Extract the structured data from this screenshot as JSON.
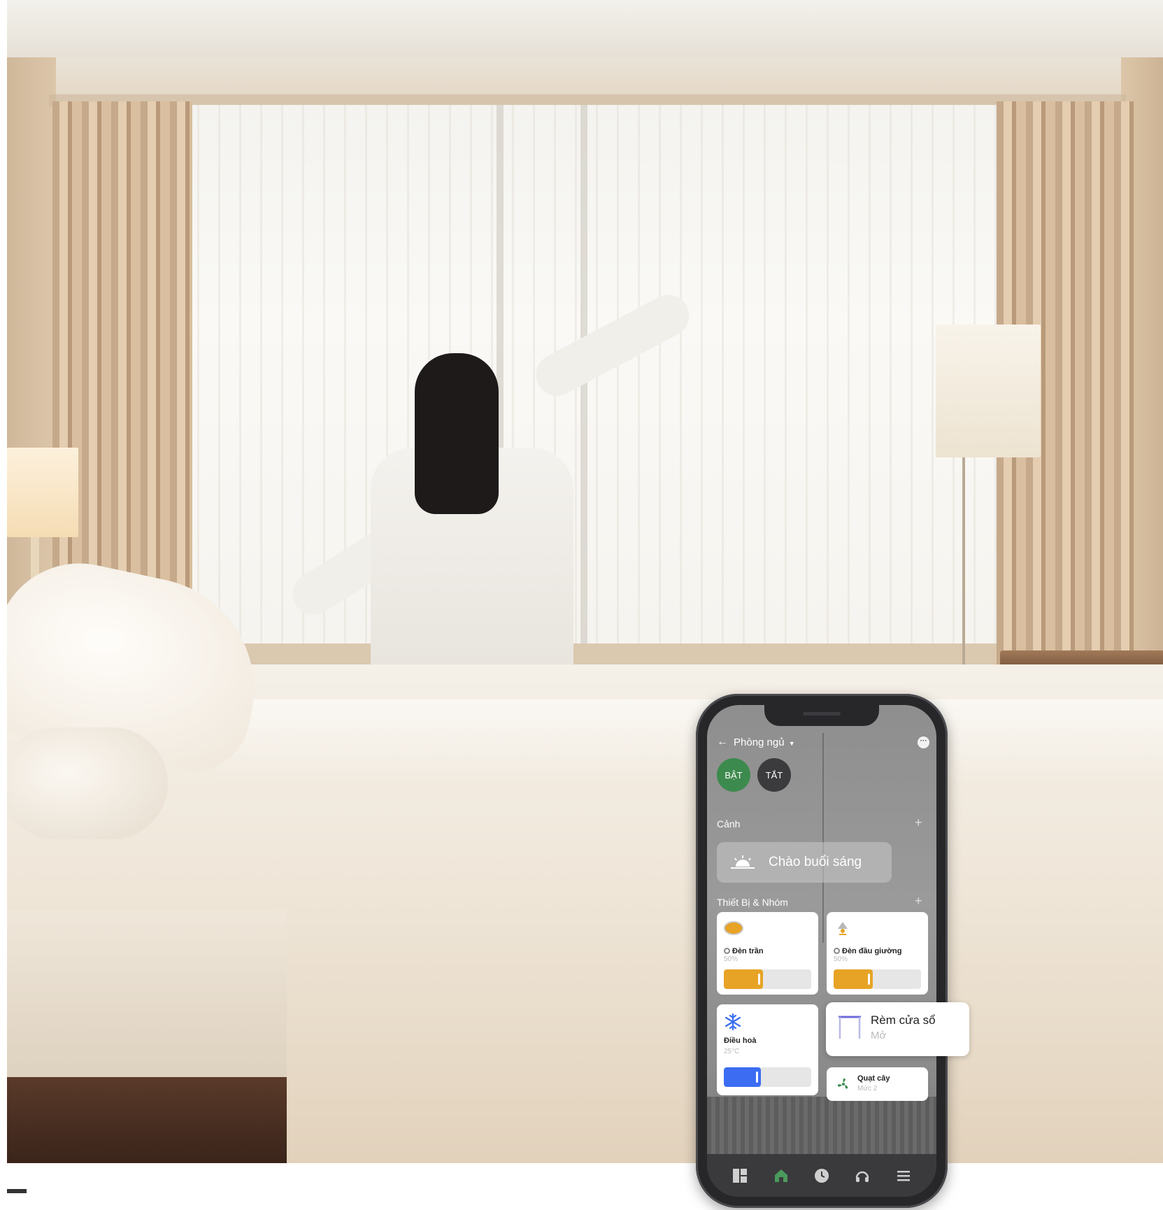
{
  "app": {
    "header": {
      "back_icon": "arrow-left-icon",
      "room_title": "Phòng ngủ",
      "dropdown_icon": "caret-down-icon",
      "more_icon": "more-horizontal-icon"
    },
    "power": {
      "on_label": "BẬT",
      "off_label": "TẮT"
    },
    "scenes": {
      "section_title": "Cảnh",
      "add_icon": "plus-icon",
      "items": [
        {
          "label": "Chào buổi sáng",
          "icon": "sunrise-icon"
        }
      ]
    },
    "devices": {
      "section_title": "Thiết Bị & Nhóm",
      "add_icon": "plus-icon",
      "items": [
        {
          "name": "Đèn trần",
          "status": "50%",
          "icon": "ceiling-light-icon",
          "level": 0.45,
          "bar_color": "#e7a325"
        },
        {
          "name": "Đèn đầu giường",
          "status": "50%",
          "icon": "bedside-lamp-icon",
          "level": 0.45,
          "bar_color": "#e7a325"
        },
        {
          "name": "Điều hoà",
          "status": "25°C",
          "icon": "snowflake-icon",
          "level": 0.42,
          "bar_color": "#3b6cf2"
        },
        {
          "name": "Rèm cửa sổ",
          "status": "Mở",
          "icon": "curtain-icon"
        },
        {
          "name": "Quạt cây",
          "status": "Mức 2",
          "icon": "fan-icon"
        }
      ]
    },
    "tabbar": {
      "items": [
        {
          "name": "dashboard",
          "icon": "dashboard-icon",
          "active": false
        },
        {
          "name": "home",
          "icon": "home-icon",
          "active": true
        },
        {
          "name": "schedule",
          "icon": "clock-icon",
          "active": false
        },
        {
          "name": "support",
          "icon": "headphones-icon",
          "active": false
        },
        {
          "name": "menu",
          "icon": "menu-icon",
          "active": false
        }
      ]
    },
    "colors": {
      "accent_on": "#3d8a4e",
      "off_button": "#3b3b3d",
      "light_bar": "#e7a325",
      "ac_bar": "#3b6cf2",
      "tab_active": "#4b9a5d"
    }
  }
}
